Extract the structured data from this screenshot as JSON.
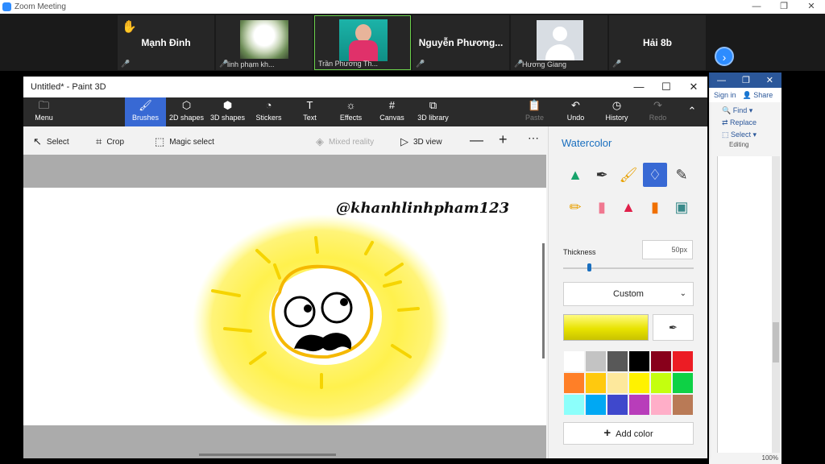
{
  "zoom": {
    "title": "Zoom Meeting",
    "window_controls": [
      "—",
      "❐",
      "✕"
    ],
    "participants": [
      {
        "name": "Mạnh Đinh",
        "label": ""
      },
      {
        "name": "",
        "label": "linh phạm kh..."
      },
      {
        "name": "",
        "label": "Trần Phương Th..."
      },
      {
        "name": "Nguyễn  Phương...",
        "label": ""
      },
      {
        "name": "",
        "label": "Hương Giang"
      },
      {
        "name": "Hải 8b",
        "label": ""
      }
    ],
    "next_icon": "chevron-right-icon"
  },
  "word": {
    "sign_in": "Sign in",
    "share": "Share",
    "find": "Find",
    "replace": "Replace",
    "select": "Select",
    "editing": "Editing",
    "zoom_level": "100%"
  },
  "paint": {
    "title": "Untitled* - Paint 3D",
    "menu": "Menu",
    "tools": [
      "Brushes",
      "2D shapes",
      "3D shapes",
      "Stickers",
      "Text",
      "Effects",
      "Canvas",
      "3D library"
    ],
    "paste": "Paste",
    "undo": "Undo",
    "history": "History",
    "redo": "Redo",
    "commands": {
      "select": "Select",
      "crop": "Crop",
      "magic_select": "Magic select",
      "mixed_reality": "Mixed reality",
      "view3d": "3D view"
    },
    "watermark": "@khanhlinhpham123",
    "panel": {
      "title": "Watercolor",
      "selected_brush": "watercolor-brush",
      "thickness_label": "Thickness",
      "thickness_value": "50px",
      "thickness_fraction": 0.2,
      "color_mode": "Custom",
      "current_color": "#e8e300",
      "palette": [
        "#ffffff",
        "#c3c3c3",
        "#585858",
        "#000000",
        "#88001b",
        "#ec1c24",
        "#ff7f27",
        "#ffc90e",
        "#fde89c",
        "#fff200",
        "#c4ff0e",
        "#0ed145",
        "#8cfffb",
        "#00a8f3",
        "#3f48cc",
        "#b83dba",
        "#ffaec8",
        "#b97a56"
      ],
      "add_color": "Add color"
    }
  }
}
